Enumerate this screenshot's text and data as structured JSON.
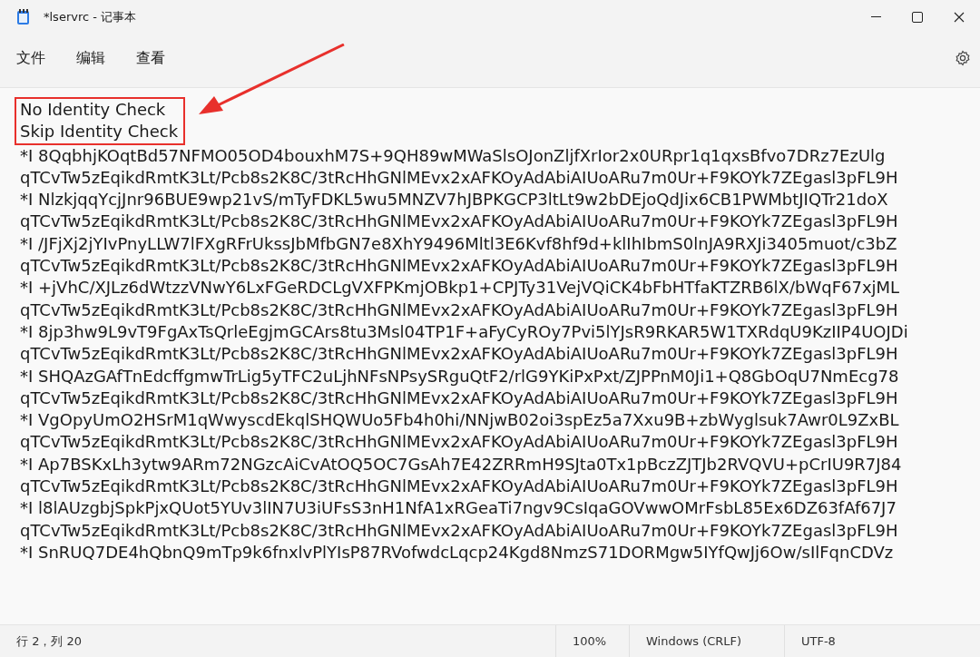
{
  "window": {
    "title": "*lservrc - 记事本"
  },
  "menu": [
    "文件",
    "编辑",
    "查看"
  ],
  "editor": {
    "highlighted_lines": [
      "No Identity Check",
      "Skip Identity Check"
    ],
    "lines": [
      "*I 8QqbhjKOqtBd57NFMO05OD4bouxhM7S+9QH89wMWaSlsOJonZljfXrIor2x0URpr1q1qxsBfvo7DRz7EzUlg",
      "qTCvTw5zEqikdRmtK3Lt/Pcb8s2K8C/3tRcHhGNlMEvx2xAFKOyAdAbiAIUoARu7m0Ur+F9KOYk7ZEgasl3pFL9H",
      "*I NlzkjqqYcjJnr96BUE9wp21vS/mTyFDKL5wu5MNZV7hJBPKGCP3ltLt9w2bDEjoQdJix6CB1PWMbtJIQTr21doX",
      "qTCvTw5zEqikdRmtK3Lt/Pcb8s2K8C/3tRcHhGNlMEvx2xAFKOyAdAbiAIUoARu7m0Ur+F9KOYk7ZEgasl3pFL9H",
      "*I /JFjXj2jYIvPnyLLW7lFXgRFrUkssJbMfbGN7e8XhY9496Mltl3E6Kvf8hf9d+klIhIbmS0lnJA9RXJi3405muot/c3bZ",
      "qTCvTw5zEqikdRmtK3Lt/Pcb8s2K8C/3tRcHhGNlMEvx2xAFKOyAdAbiAIUoARu7m0Ur+F9KOYk7ZEgasl3pFL9H",
      "*I +jVhC/XJLz6dWtzzVNwY6LxFGeRDCLgVXFPKmjOBkp1+CPJTy31VejVQiCK4bFbHTfaKTZRB6lX/bWqF67xjML",
      "qTCvTw5zEqikdRmtK3Lt/Pcb8s2K8C/3tRcHhGNlMEvx2xAFKOyAdAbiAIUoARu7m0Ur+F9KOYk7ZEgasl3pFL9H",
      "*I 8jp3hw9L9vT9FgAxTsQrleEgjmGCArs8tu3Msl04TP1F+aFyCyROy7Pvi5lYJsR9RKAR5W1TXRdqU9KzIIP4UOJDi",
      "qTCvTw5zEqikdRmtK3Lt/Pcb8s2K8C/3tRcHhGNlMEvx2xAFKOyAdAbiAIUoARu7m0Ur+F9KOYk7ZEgasl3pFL9H",
      "*I SHQAzGAfTnEdcffgmwTrLig5yTFC2uLjhNFsNPsySRguQtF2/rlG9YKiPxPxt/ZJPPnM0Ji1+Q8GbOqU7NmEcg78",
      "qTCvTw5zEqikdRmtK3Lt/Pcb8s2K8C/3tRcHhGNlMEvx2xAFKOyAdAbiAIUoARu7m0Ur+F9KOYk7ZEgasl3pFL9H",
      "*I VgOpyUmO2HSrM1qWwyscdEkqlSHQWUo5Fb4h0hi/NNjwB02oi3spEz5a7Xxu9B+zbWyglsuk7Awr0L9ZxBL",
      "qTCvTw5zEqikdRmtK3Lt/Pcb8s2K8C/3tRcHhGNlMEvx2xAFKOyAdAbiAIUoARu7m0Ur+F9KOYk7ZEgasl3pFL9H",
      "*I Ap7BSKxLh3ytw9ARm72NGzcAiCvAtOQ5OC7GsAh7E42ZRRmH9SJta0Tx1pBczZJTJb2RVQVU+pCrIU9R7J84",
      "qTCvTw5zEqikdRmtK3Lt/Pcb8s2K8C/3tRcHhGNlMEvx2xAFKOyAdAbiAIUoARu7m0Ur+F9KOYk7ZEgasl3pFL9H",
      "*I l8lAUzgbjSpkPjxQUot5YUv3lIN7U3iUFsS3nH1NfA1xRGeaTi7ngv9CsIqaGOVwwOMrFsbL85Ex6DZ63fAf67J7",
      "qTCvTw5zEqikdRmtK3Lt/Pcb8s2K8C/3tRcHhGNlMEvx2xAFKOyAdAbiAIUoARu7m0Ur+F9KOYk7ZEgasl3pFL9H",
      "*I SnRUQ7DE4hQbnQ9mTp9k6fnxlvPlYIsP87RVofwdcLqcp24Kgd8NmzS71DORMgw5IYfQwJj6Ow/sIlFqnCDVz"
    ]
  },
  "status_bar": {
    "position": "行 2，列 20",
    "zoom": "100%",
    "line_ending": "Windows (CRLF)",
    "encoding": "UTF-8"
  }
}
